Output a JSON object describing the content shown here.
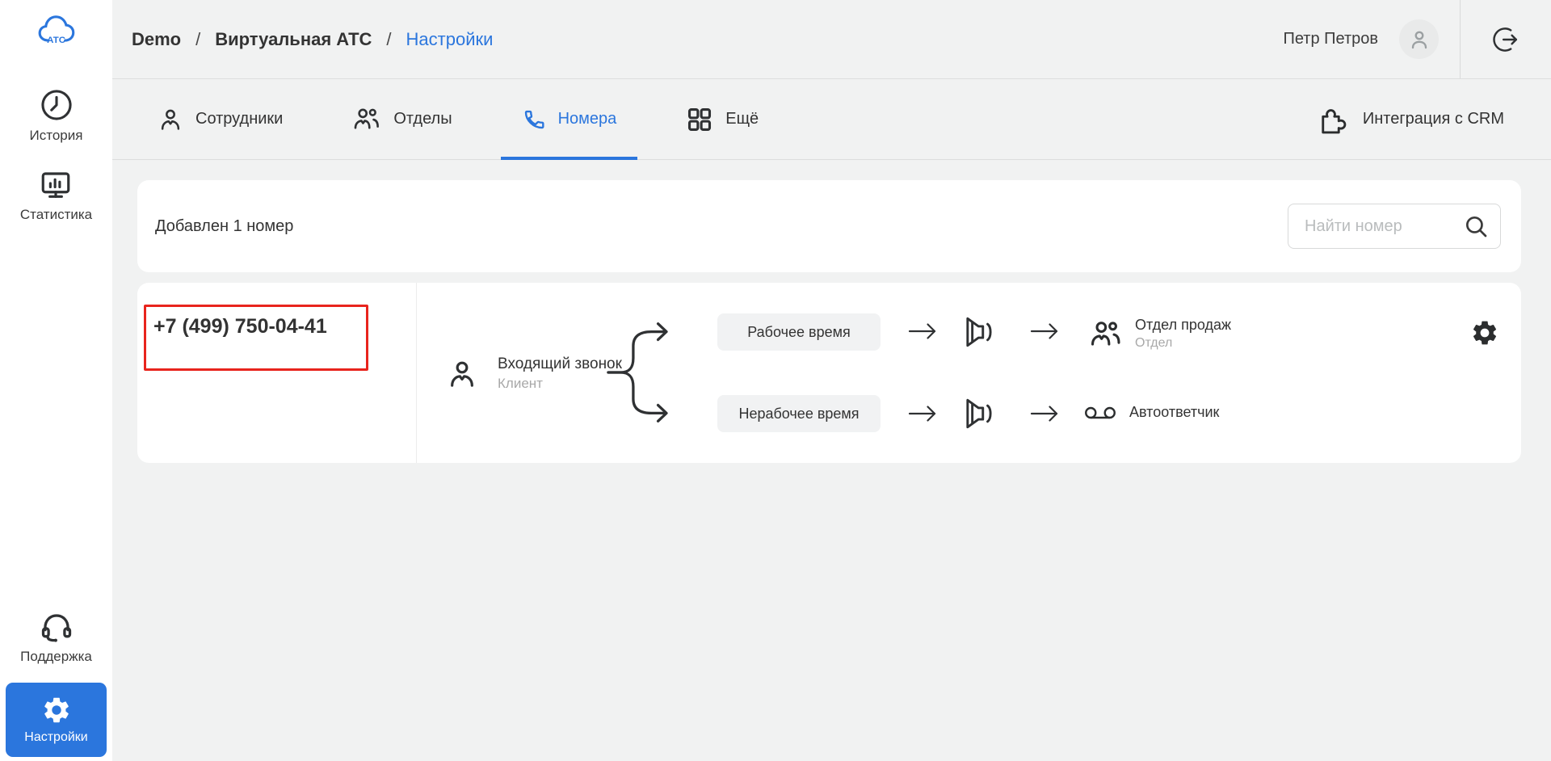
{
  "colors": {
    "accent": "#2b76dd",
    "highlight_red": "#e8241d"
  },
  "brand": {
    "logo_text": "АТС"
  },
  "sidebar": {
    "history_label": "История",
    "stats_label": "Статистика",
    "support_label": "Поддержка",
    "settings_label": "Настройки"
  },
  "header": {
    "breadcrumb": {
      "root": "Demo",
      "section": "Виртуальная АТС",
      "current": "Настройки",
      "separator": "/"
    },
    "user_name": "Петр Петров"
  },
  "tabs": {
    "employees": "Сотрудники",
    "departments": "Отделы",
    "numbers": "Номера",
    "more": "Ещё",
    "crm": "Интеграция с CRM"
  },
  "toolbar": {
    "status_text": "Добавлен 1 номер",
    "search_placeholder": "Найти номер"
  },
  "number_card": {
    "phone_number": "+7 (499) 750-04-41",
    "source_title": "Входящий звонок",
    "source_subtitle": "Клиент",
    "work_branch": {
      "condition": "Рабочее время",
      "target_title": "Отдел продаж",
      "target_subtitle": "Отдел"
    },
    "offwork_branch": {
      "condition": "Нерабочее время",
      "target_title": "Автоответчик"
    }
  }
}
